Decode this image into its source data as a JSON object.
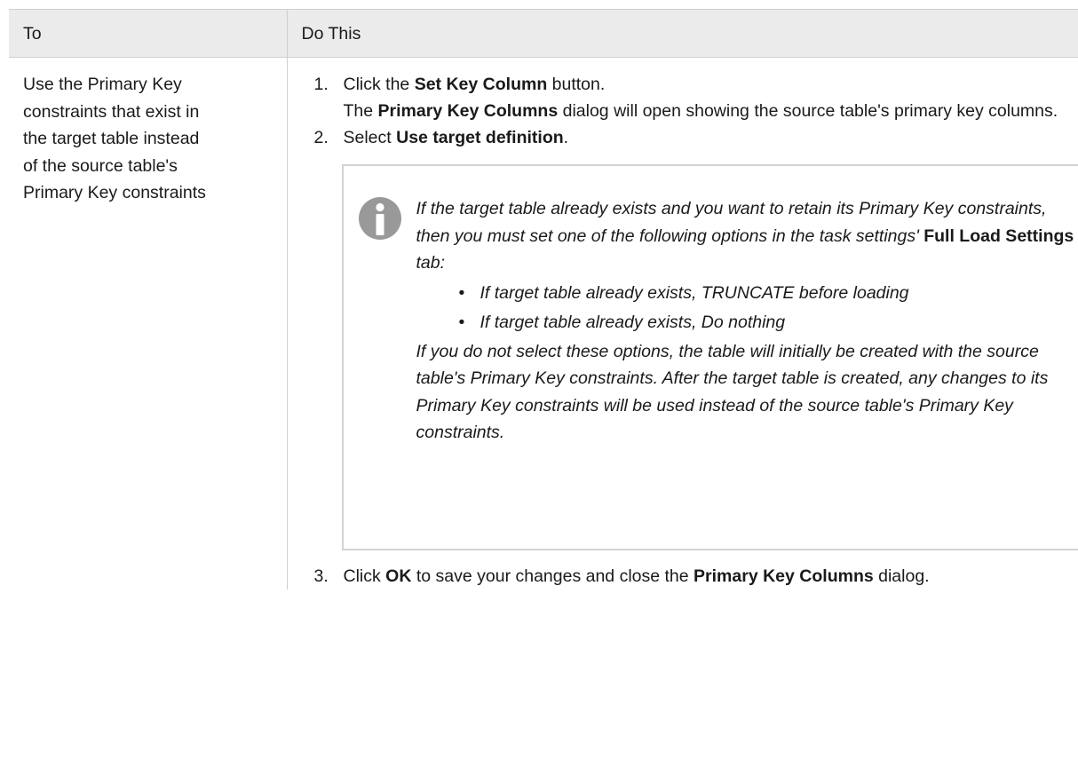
{
  "table": {
    "header": {
      "col_to": "To",
      "col_do": "Do This"
    },
    "row": {
      "to_text": "Use the Primary Key constraints that exist in the target table instead of the source table's Primary Key constraints",
      "to_lines": [
        "Use the Primary Key",
        "constraints that exist in",
        "the target table instead",
        "of the source table's",
        "Primary Key constraints"
      ]
    }
  },
  "steps": [
    {
      "num": "1.",
      "pre": "Click the ",
      "bold": "Set Key Column",
      "post": " button.",
      "line2_bold": "Primary Key Columns",
      "line2_pre": "The ",
      "line2_post": " dialog will open showing the source table's primary key columns."
    },
    {
      "num": "2.",
      "pre": "Select ",
      "bold": "Use target definition",
      "post": "."
    },
    {
      "num": "3.",
      "pre": "Click ",
      "bold": "OK",
      "mid": " to save your changes and close the ",
      "bold2": "Primary Key Columns",
      "post": " dialog."
    }
  ],
  "note": {
    "icon": "info-icon",
    "icon_color": "#999999",
    "intro_pre": "If the target table already exists and you want to retain its Primary Key constraints, then you must set one of the following options in the task settings' ",
    "intro_bold": "Full Load Settings",
    "intro_post": " tab:",
    "bullets": [
      "If target table already exists, TRUNCATE before loading",
      "If target table already exists, Do nothing"
    ],
    "outro": "If you do not select these options, the table will initially be created with the source table's Primary Key constraints. After the target table is created, any changes to its Primary Key constraints will be used instead of the source table's Primary Key constraints."
  },
  "colors": {
    "header_bg": "#ebebeb",
    "border": "#cfcfcf",
    "note_border": "#d3d3d3",
    "text": "#1a1a1a"
  }
}
